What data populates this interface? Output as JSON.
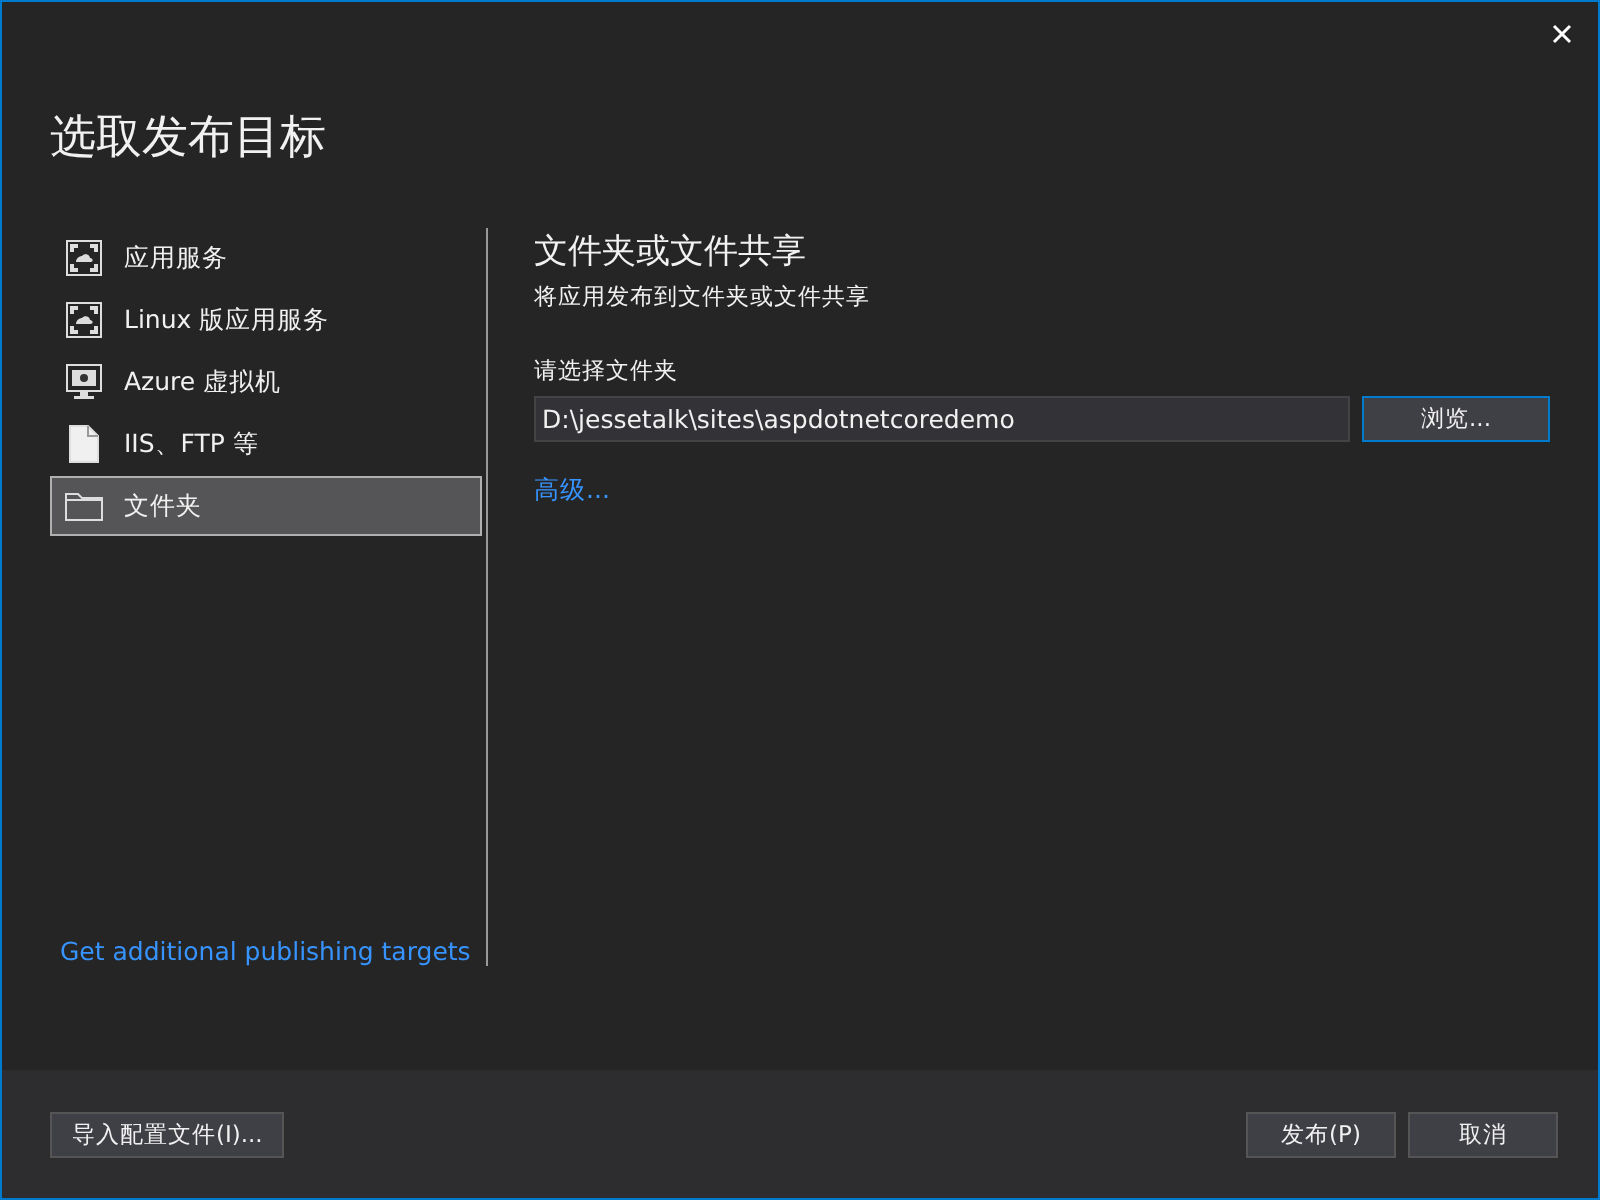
{
  "window": {
    "title": "选取发布目标"
  },
  "targets": [
    {
      "label": "应用服务",
      "kind": "service",
      "selected": false
    },
    {
      "label": "Linux 版应用服务",
      "kind": "service",
      "selected": false
    },
    {
      "label": "Azure 虚拟机",
      "kind": "monitor",
      "selected": false
    },
    {
      "label": "IIS、FTP 等",
      "kind": "document",
      "selected": false
    },
    {
      "label": "文件夹",
      "kind": "folder",
      "selected": true
    }
  ],
  "more_link": "Get additional publishing targets",
  "detail": {
    "title": "文件夹或文件共享",
    "subtitle": "将应用发布到文件夹或文件共享",
    "field_label": "请选择文件夹",
    "folder_value": "D:\\jessetalk\\sites\\aspdotnetcoredemo",
    "browse": "浏览...",
    "advanced": "高级..."
  },
  "footer": {
    "import": "导入配置文件(I)...",
    "buttons": [
      "发布(P)",
      "取消"
    ]
  }
}
